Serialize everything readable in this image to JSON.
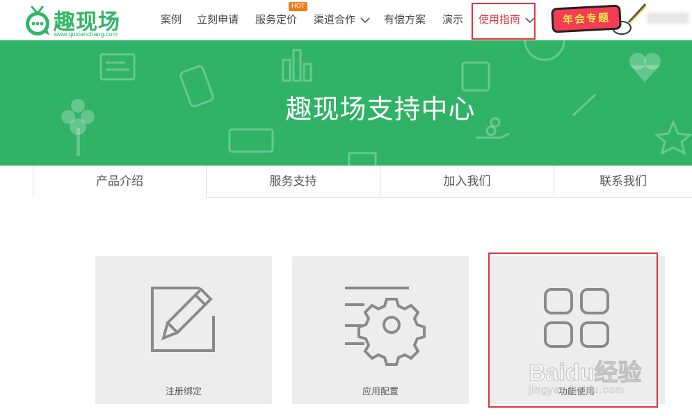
{
  "header": {
    "logo": {
      "text": "趣现场",
      "domain": "www.quxianchang.com"
    },
    "nav": [
      {
        "label": "案例"
      },
      {
        "label": "立刻申请"
      },
      {
        "label": "服务定价",
        "badge": "HOT"
      },
      {
        "label": "渠道合作",
        "dropdown": true
      },
      {
        "label": "有偿方案"
      },
      {
        "label": "演示"
      },
      {
        "label": "使用指南",
        "dropdown": true,
        "active": true
      }
    ],
    "promo_label": "年会专题"
  },
  "banner": {
    "title": "趣现场支持中心",
    "background": "#30b366"
  },
  "tabs": [
    {
      "label": "产品介绍",
      "selected": true
    },
    {
      "label": "服务支持"
    },
    {
      "label": "加入我们"
    },
    {
      "label": "联系我们"
    }
  ],
  "cards": [
    {
      "label": "注册绑定",
      "icon": "edit-icon"
    },
    {
      "label": "应用配置",
      "icon": "settings-icon"
    },
    {
      "label": "功能使用",
      "icon": "grid-icon"
    }
  ],
  "watermark": {
    "brand": "Baidu经验",
    "url": "jingyan.baidu.com"
  },
  "colors": {
    "brand_green": "#31b566",
    "active_red": "#d8343d",
    "card_bg": "#eeedee",
    "icon_gray": "#8a8a8a"
  }
}
